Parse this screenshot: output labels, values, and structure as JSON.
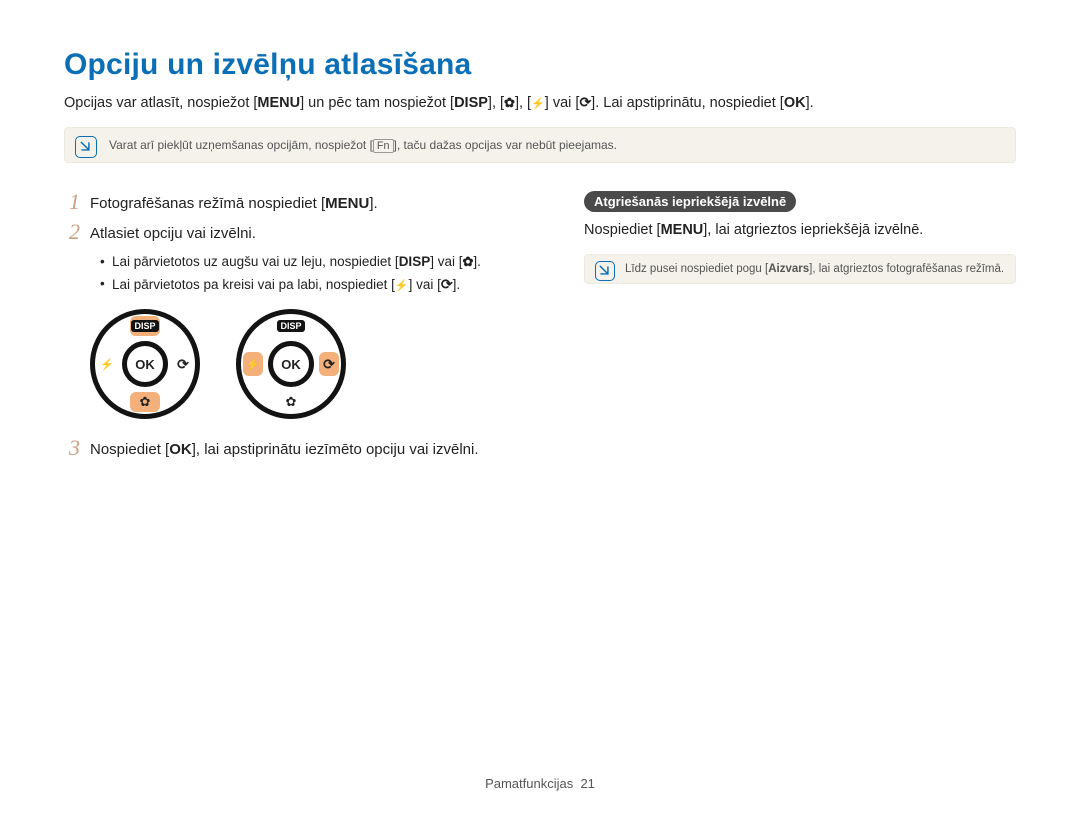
{
  "title": "Opciju un izvēlņu atlasīšana",
  "intro": {
    "p1a": "Opcijas var atlasīt, nospiežot [",
    "menu": "MENU",
    "p1b": "] un pēc tam nospiežot [",
    "disp": "DISP",
    "p1c": "], [",
    "flower": "❿",
    "p1d": "], [",
    "bolt": "⚡",
    "p1e": "] vai [",
    "timer": "⟳",
    "p1f": "]. Lai apstiprinātu, nospiediet [",
    "ok": "OK",
    "p1g": "]."
  },
  "note1": {
    "a": "Varat arī piekļūt uzņemšanas opcijām, nospiežot [",
    "fn": "Fn",
    "b": "], taču dažas opcijas var nebūt pieejamas."
  },
  "steps": {
    "s1": {
      "num": "1",
      "a": "Fotografēšanas režīmā nospiediet [",
      "menu": "MENU",
      "b": "]."
    },
    "s2": {
      "num": "2",
      "text": "Atlasiet opciju vai izvēlni."
    },
    "bullets": {
      "b1": {
        "a": "Lai pārvietotos uz augšu vai uz leju, nospiediet [",
        "disp": "DISP",
        "b": "] vai [",
        "flower": "❿",
        "c": "]."
      },
      "b2": {
        "a": "Lai pārvietotos pa kreisi vai pa labi, nospiediet [",
        "bolt": "⚡",
        "b": "] vai [",
        "timer": "⟳",
        "c": "]."
      }
    },
    "s3": {
      "num": "3",
      "a": "Nospiediet [",
      "ok": "OK",
      "b": "], lai apstiprinātu iezīmēto opciju vai izvēlni."
    }
  },
  "dials": {
    "ok": "OK",
    "disp": "DISP"
  },
  "right": {
    "heading": "Atgriešanās iepriekšējā izvēlnē",
    "line": {
      "a": "Nospiediet [",
      "menu": "MENU",
      "b": "], lai atgrieztos iepriekšējā izvēlnē."
    },
    "note": {
      "a": "Līdz pusei nospiediet pogu [",
      "aizvars": "Aizvars",
      "b": "], lai atgrieztos fotografēšanas režīmā."
    }
  },
  "footer": {
    "section": "Pamatfunkcijas",
    "page": "21"
  }
}
